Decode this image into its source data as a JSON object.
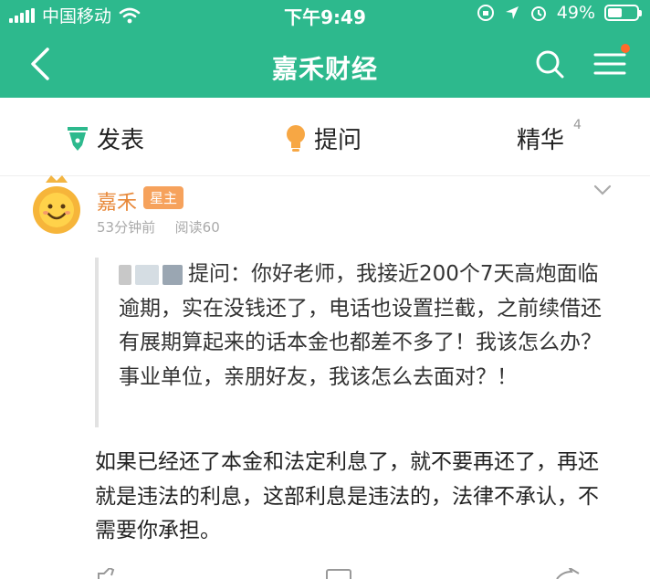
{
  "status_bar": {
    "carrier": "中国移动",
    "time": "下午9:49",
    "battery": "49%",
    "battery_level": 0.49
  },
  "nav": {
    "title": "嘉禾财经",
    "icons": [
      "back-icon",
      "search-icon",
      "menu-icon"
    ]
  },
  "tabs": [
    {
      "label": "发表",
      "icon": "pen-icon"
    },
    {
      "label": "提问",
      "icon": "bulb-icon"
    },
    {
      "label": "精华",
      "count": "4"
    }
  ],
  "post": {
    "author": "嘉禾",
    "badge": "星主",
    "time_ago": "53分钟前",
    "reads": "阅读60",
    "quote_prefix": "提问：你好老师，我接近200个7天",
    "quote_rest": "高炮面临逾期，实在没钱还了，电话也设置拦截，之前续借还有展期算起来的话本金也都差不多了！我该怎么办？事业单位，亲朋好友，我该怎么去面对？！",
    "answer": "如果已经还了本金和法定利息了，就不要再还了，再还就是违法的利息，这部利息是违法的，法律不承认，不需要你承担。"
  },
  "colors": {
    "header": "#2db98d",
    "author": "#e8893a",
    "badge": "#f6a25c",
    "notification_dot": "#ff6a2a"
  }
}
